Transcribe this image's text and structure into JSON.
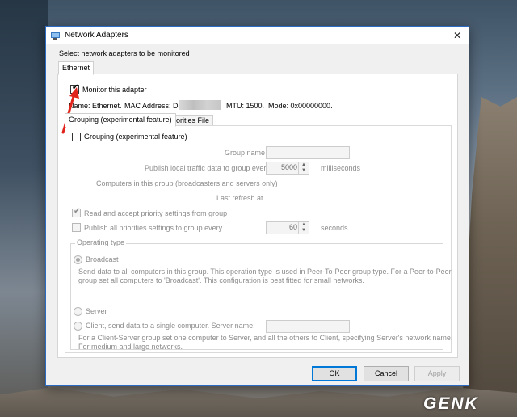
{
  "window": {
    "title": "Network Adapters",
    "close_label": "✕"
  },
  "header_label": "Select network adapters to be monitored",
  "adapter_tabs": [
    {
      "label": "Ethernet"
    }
  ],
  "monitor_checkbox": {
    "label": "Monitor this adapter",
    "checked": true
  },
  "adapter_info": {
    "name_text": "Name: Ethernet.",
    "mac_prefix": "MAC Address: D8",
    "mtu_text": "MTU: 1500.",
    "mode_text": "Mode: 0x00000000."
  },
  "sub_tabs": [
    {
      "label": "Grouping (experimental feature)",
      "active": true
    },
    {
      "label": "Priorities File",
      "active": false
    }
  ],
  "grouping": {
    "enable_label": "Grouping (experimental feature)",
    "group_name_label": "Group name",
    "group_name_value": "",
    "publish_label": "Publish local traffic data to group every",
    "publish_value": "5000",
    "publish_unit": "milliseconds",
    "computers_label": "Computers in this group (broadcasters and servers only)",
    "last_refresh_label": "Last refresh at",
    "last_refresh_value": "...",
    "read_priority_label": "Read and accept priority settings from group",
    "publish_priorities_label": "Publish all priorities settings to group every",
    "publish_priorities_value": "60",
    "publish_priorities_unit": "seconds"
  },
  "operating_type": {
    "legend": "Operating type",
    "broadcast_label": "Broadcast",
    "broadcast_desc_1": "Send data to all computers in this group. This operation type is used in Peer-To-Peer group type. For a Peer-to-Peer",
    "broadcast_desc_2": "group set all computers to 'Broadcast'. This configuration is best fitted for small networks.",
    "server_label": "Server",
    "client_label": "Client, send data to a single computer. Server name:",
    "client_server_value": "",
    "client_desc_1": "For a Client-Server group set one computer to Server, and all the others to Client, specifying Server's network name.",
    "client_desc_2": "For medium and large networks."
  },
  "buttons": {
    "ok": "OK",
    "cancel": "Cancel",
    "apply": "Apply"
  },
  "watermark": {
    "text": "GENK"
  },
  "colors": {
    "accent": "#0078d7",
    "annotation_arrow": "#e0241b",
    "title_border": "#2b6cc2"
  }
}
